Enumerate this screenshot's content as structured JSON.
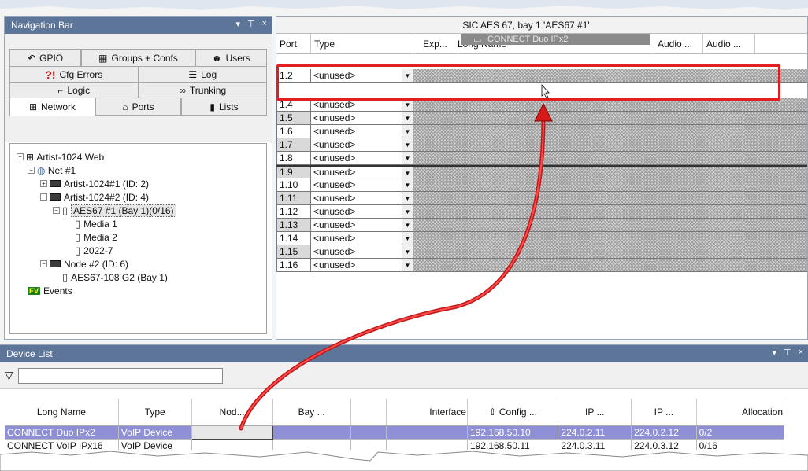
{
  "navigation_bar": {
    "title": "Navigation Bar",
    "title_controls": [
      "▾",
      "⊤",
      "×"
    ],
    "tabs_row1": [
      "GPIO",
      "Groups + Confs",
      "Users"
    ],
    "tabs_row2": [
      "Cfg Errors",
      "Log"
    ],
    "tabs_row3": [
      "Logic",
      "Trunking"
    ],
    "tabs_row4": [
      "Network",
      "Ports",
      "Lists"
    ],
    "tree": [
      "Artist-1024 Web",
      "Net #1",
      "Artist-1024#1 (ID: 2)",
      "Artist-1024#2 (ID: 4)",
      "AES67 #1 (Bay  1)(0/16)",
      "Media 1",
      "Media 2",
      "2022-7",
      "Node #2 (ID: 6)",
      "AES67-108 G2 (Bay  1)",
      "Events"
    ]
  },
  "sic_grid": {
    "title": "SIC AES 67, bay 1 'AES67 #1'",
    "columns": [
      "Port",
      "Type",
      "Exp...",
      "Long Name",
      "Audio ...",
      "Audio ..."
    ],
    "rows": [
      {
        "port": "1.2",
        "type": "<unused>"
      },
      {
        "port": "1.4",
        "type": "<unused>"
      },
      {
        "port": "1.5",
        "type": "<unused>"
      },
      {
        "port": "1.6",
        "type": "<unused>"
      },
      {
        "port": "1.7",
        "type": "<unused>"
      },
      {
        "port": "1.8",
        "type": "<unused>"
      },
      {
        "port": "1.9",
        "type": "<unused>"
      },
      {
        "port": "1.10",
        "type": "<unused>"
      },
      {
        "port": "1.11",
        "type": "<unused>"
      },
      {
        "port": "1.12",
        "type": "<unused>"
      },
      {
        "port": "1.13",
        "type": "<unused>"
      },
      {
        "port": "1.14",
        "type": "<unused>"
      },
      {
        "port": "1.15",
        "type": "<unused>"
      },
      {
        "port": "1.16",
        "type": "<unused>"
      }
    ],
    "drag_label": "CONNECT Duo IPx2"
  },
  "device_list": {
    "title": "Device List",
    "title_controls": [
      "▾",
      "⊤",
      "×"
    ],
    "columns": [
      "Long Name",
      "Type",
      "Nod...",
      "Bay ...",
      "",
      "Interface",
      "Config ...",
      "IP ...",
      "IP ...",
      "Allocation"
    ],
    "rows": [
      {
        "long_name": "CONNECT Duo IPx2",
        "type": "VoIP Device",
        "node": "",
        "bay": "",
        "blank": "",
        "interface": "",
        "config": "192.168.50.10",
        "ip1": "224.0.2.11",
        "ip2": "224.0.2.12",
        "allocation": "0/2"
      },
      {
        "long_name": "CONNECT VoIP IPx16",
        "type": "VoIP Device",
        "node": "",
        "bay": "",
        "blank": "",
        "interface": "",
        "config": "192.168.50.11",
        "ip1": "224.0.3.11",
        "ip2": "224.0.3.12",
        "allocation": "0/16"
      }
    ]
  },
  "colors": {
    "accent": "#5d7599",
    "highlight_border": "#e02020",
    "selection": "#8e8fd6"
  }
}
